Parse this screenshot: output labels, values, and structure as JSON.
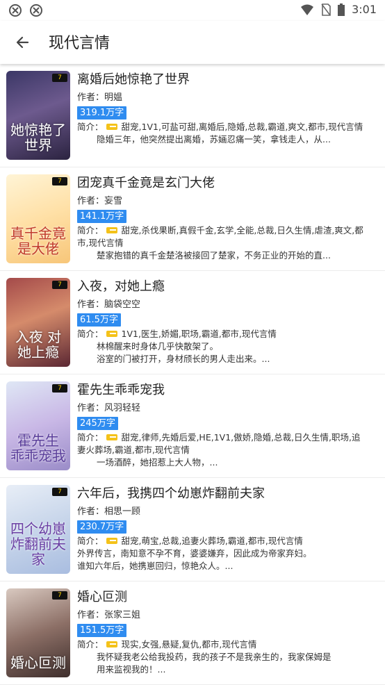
{
  "status_bar": {
    "time": "3:01"
  },
  "app_bar": {
    "title": "现代言情"
  },
  "books": [
    {
      "title": "离婚后她惊艳了世界",
      "author_label": "作者：",
      "author": "明媪",
      "words": "319.1万字",
      "intro_label": "简介：",
      "tags": "甜宠,1V1,可盐可甜,离婚后,隐婚,总裁,霸道,爽文,都市,现代言情",
      "desc": "隐婚三年，他突然提出离婚，苏婳忍痛一笑，拿钱走人，从...",
      "cover_text": "她惊艳了世界",
      "cover_badge": "7"
    },
    {
      "title": "团宠真千金竟是玄门大佬",
      "author_label": "作者：",
      "author": "妄雪",
      "words": "141.1万字",
      "intro_label": "简介：",
      "tags": "甜宠,杀伐果断,真假千金,玄学,全能,总裁,日久生情,虐渣,爽文,都市,现代言情",
      "desc": "楚家抱错的真千金楚洛被接回了楚家，不务正业的开始的直...",
      "cover_text": "真千金竟是大佬",
      "cover_badge": "7"
    },
    {
      "title": "入夜，对她上瘾",
      "author_label": "作者：",
      "author": "脑袋空空",
      "words": "61.5万字",
      "intro_label": "简介：",
      "tags": "1V1,医生,娇媚,职场,霸道,都市,现代言情",
      "desc": "林棉醒来时身体几乎快散架了。\n浴室的门被打开，身材颀长的男人走出来。...",
      "cover_text": "入夜 对她上瘾",
      "cover_badge": "7"
    },
    {
      "title": "霍先生乖乖宠我",
      "author_label": "作者：",
      "author": "风羽轻轻",
      "words": "245万字",
      "intro_label": "简介：",
      "tags": "甜宠,律师,先婚后爱,HE,1V1,傲娇,隐婚,总裁,日久生情,职场,追妻火葬场,霸道,都市,现代言情",
      "desc": "一场酒醉，她招惹上大人物，...",
      "cover_text": "霍先生 乖乖宠我",
      "cover_badge": "7"
    },
    {
      "title": "六年后，我携四个幼崽炸翻前夫家",
      "author_label": "作者：",
      "author": "相思一顾",
      "words": "230.7万字",
      "intro_label": "简介：",
      "tags": "甜宠,萌宝,总裁,追妻火葬场,霸道,都市,现代言情",
      "desc": "外界传言，南知意不孕不育，婆婆嫌弃，因此成为帝家弃妇。\n谁知六年后，她携崽回归，惊艳众人。...",
      "cover_text": "四个幼崽 炸翻前夫家",
      "cover_badge": "7"
    },
    {
      "title": "婚心叵测",
      "author_label": "作者：",
      "author": "张家三姐",
      "words": "151.5万字",
      "intro_label": "简介：",
      "tags": "现实,女强,悬疑,复仇,都市,现代言情",
      "desc": "我怀疑我老公给我投药，我的孩子不是我亲生的，我家保姆是\n用来监视我的！...",
      "cover_text": "婚心叵测",
      "cover_badge": "7"
    }
  ],
  "colors": {
    "accent": "#2f8cf0",
    "tag_icon": "#f4c21a"
  }
}
